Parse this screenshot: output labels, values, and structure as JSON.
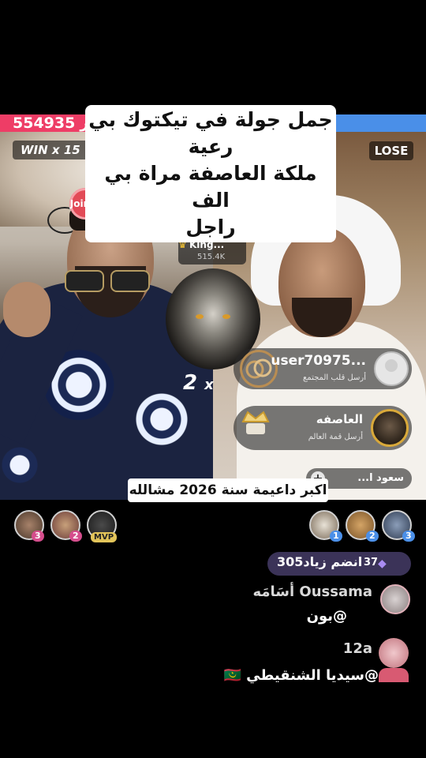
{
  "caption": {
    "line1": "جمل جولة في تيكتوك بي رعية",
    "line2": "ملكة العاصفة مراة بي الف",
    "line3": "راجل"
  },
  "battle": {
    "score_left": "554935",
    "score_suffix": "ر",
    "win_label": "WIN",
    "win_multiplier": "x 15",
    "lose_label": "LOSE",
    "left_color": "#ee3d66",
    "right_color": "#4a8fe8"
  },
  "fan_club": {
    "label": "Join my Fan Club"
  },
  "top_gifter": {
    "rank": "1",
    "name": "King...",
    "score": "515.4K"
  },
  "multiplier": {
    "value": "2",
    "suffix": "x"
  },
  "gifts": [
    {
      "username": "user70975...",
      "action": "أرسل قلب المجتمع",
      "icon": "interlocked-rings-gift-icon"
    },
    {
      "username": "العاصفه",
      "action": "أرسل قمة العالم",
      "icon": "crown-trophy-gift-icon"
    }
  ],
  "join_chip": {
    "label": "سعود ا..."
  },
  "bottom_caption": "اكبر  داعيمة سنة 2026 مشالله",
  "viewers_left": [
    {
      "badge": "3",
      "icon": "viewer-avatar"
    },
    {
      "badge": "2",
      "icon": "viewer-avatar"
    },
    {
      "badge": "MVP",
      "icon": "viewer-avatar"
    }
  ],
  "viewers_right": [
    {
      "badge": "1",
      "icon": "viewer-avatar"
    },
    {
      "badge": "2",
      "icon": "viewer-avatar"
    },
    {
      "badge": "3",
      "icon": "viewer-avatar"
    }
  ],
  "join_pill": {
    "count": "37",
    "text": "انضم زياد305"
  },
  "chat": [
    {
      "name": "Oussama أسَامَه",
      "message": "@بون"
    },
    {
      "name": "12a",
      "message": "@سيديا الشنقيطي 🇲🇷"
    }
  ]
}
